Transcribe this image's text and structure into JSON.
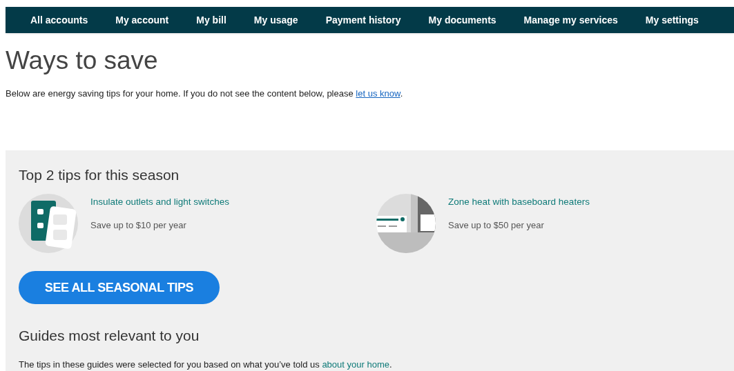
{
  "nav": [
    "All accounts",
    "My account",
    "My bill",
    "My usage",
    "Payment history",
    "My documents",
    "Manage my services",
    "My settings"
  ],
  "page_title": "Ways to save",
  "intro": {
    "before": "Below are energy saving tips for your home. If you do not see the content below, please ",
    "link": "let us know",
    "after": "."
  },
  "tips_section": {
    "title": "Top 2 tips for this season",
    "tips": [
      {
        "kind": "outlet",
        "title": "Insulate outlets and light switches",
        "saving": "Save up to $10 per year"
      },
      {
        "kind": "heater",
        "title": "Zone heat with baseboard heaters",
        "saving": "Save up to $50 per year"
      }
    ],
    "button": "SEE ALL SEASONAL TIPS"
  },
  "guides": {
    "title": "Guides most relevant to you",
    "text": {
      "before": "The tips in these guides were selected for you based on what you’ve told us ",
      "link": "about your home",
      "after": "."
    }
  }
}
